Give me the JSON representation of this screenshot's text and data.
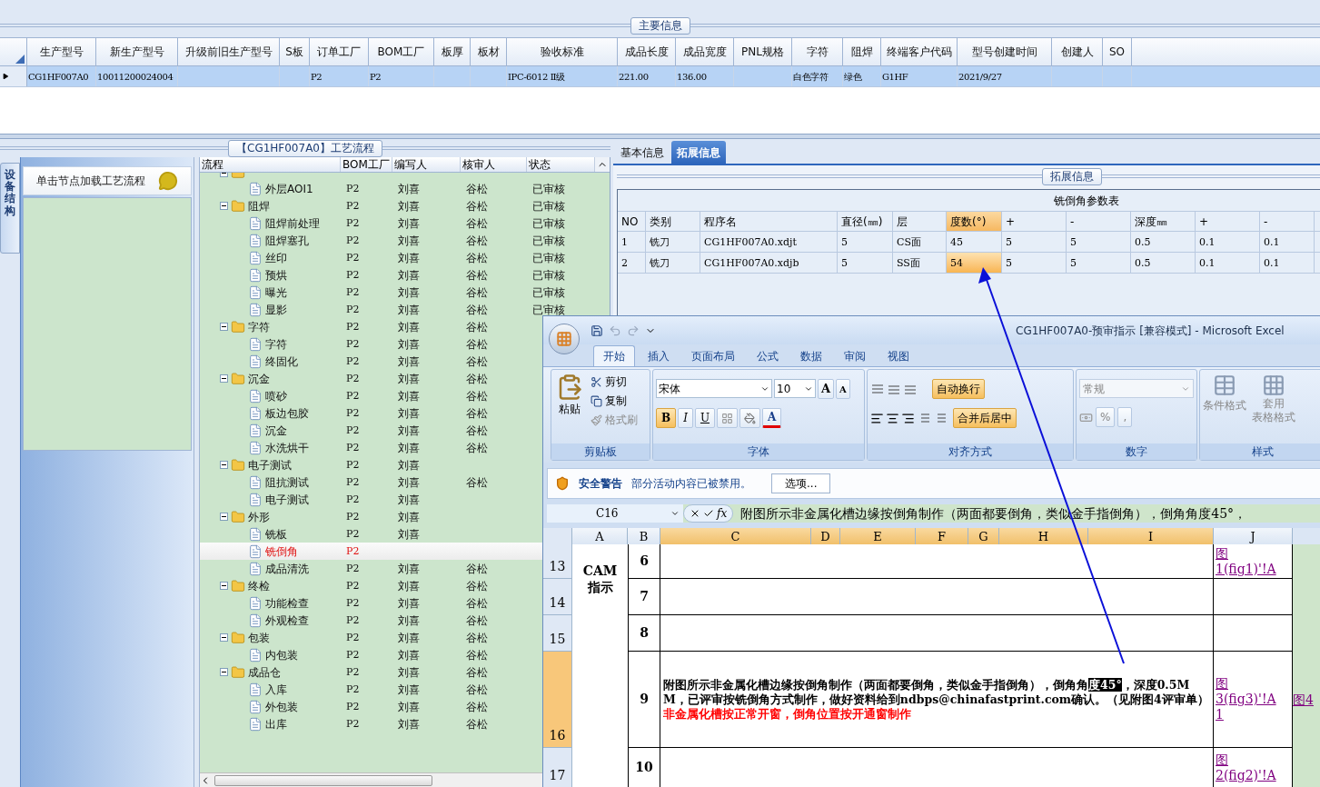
{
  "main_info": {
    "title": "主要信息",
    "columns": [
      "生产型号",
      "新生产型号",
      "升级前旧生产型号",
      "S板",
      "订单工厂",
      "BOM工厂",
      "板厚",
      "板材",
      "验收标准",
      "成品长度",
      "成品宽度",
      "PNL规格",
      "字符",
      "阻焊",
      "终端客户代码",
      "型号创建时间",
      "创建人",
      "SO"
    ],
    "rows": [
      {
        "selected": true,
        "cells": [
          "CG1HF007A0",
          "10011200024004",
          null,
          null,
          "P2",
          "P2",
          null,
          null,
          "IPC-6012 Ⅱ级",
          "221.00",
          "136.00",
          null,
          "白色字符",
          "绿色",
          "G1HF",
          "2021/9/27",
          null,
          null
        ]
      }
    ]
  },
  "process": {
    "title": "【CG1HF007A0】工艺流程",
    "side_tab": "设备结构",
    "hint": "单击节点加载工艺流程",
    "columns": [
      "流程",
      "BOM工厂",
      "编写人",
      "核审人",
      "状态"
    ],
    "tree": [
      {
        "kind": "folder",
        "selected": false,
        "children": [
          {
            "kind": "file",
            "label": "外层AOI1",
            "factory": "P2",
            "author": "刘喜",
            "reviewer": "谷松",
            "status": "已审核",
            "selected": false
          }
        ]
      },
      {
        "kind": "folder",
        "label": "阻焊",
        "factory": "P2",
        "author": "刘喜",
        "reviewer": "谷松",
        "status": "已审核",
        "selected": false,
        "children": [
          {
            "kind": "file",
            "label": "阻焊前处理",
            "factory": "P2",
            "author": "刘喜",
            "reviewer": "谷松",
            "status": "已审核",
            "selected": false
          },
          {
            "kind": "file",
            "label": "阻焊塞孔",
            "factory": "P2",
            "author": "刘喜",
            "reviewer": "谷松",
            "status": "已审核",
            "selected": false
          },
          {
            "kind": "file",
            "label": "丝印",
            "factory": "P2",
            "author": "刘喜",
            "reviewer": "谷松",
            "status": "已审核",
            "selected": false
          },
          {
            "kind": "file",
            "label": "预烘",
            "factory": "P2",
            "author": "刘喜",
            "reviewer": "谷松",
            "status": "已审核",
            "selected": false
          },
          {
            "kind": "file",
            "label": "曝光",
            "factory": "P2",
            "author": "刘喜",
            "reviewer": "谷松",
            "status": "已审核",
            "selected": false
          },
          {
            "kind": "file",
            "label": "显影",
            "factory": "P2",
            "author": "刘喜",
            "reviewer": "谷松",
            "status": "已审核",
            "selected": false
          }
        ]
      },
      {
        "kind": "folder",
        "label": "字符",
        "factory": "P2",
        "author": "刘喜",
        "reviewer": "谷松",
        "selected": false,
        "children": [
          {
            "kind": "file",
            "label": "字符",
            "factory": "P2",
            "author": "刘喜",
            "reviewer": "谷松",
            "selected": false
          },
          {
            "kind": "file",
            "label": "终固化",
            "factory": "P2",
            "author": "刘喜",
            "reviewer": "谷松",
            "selected": false
          }
        ]
      },
      {
        "kind": "folder",
        "label": "沉金",
        "factory": "P2",
        "author": "刘喜",
        "reviewer": "谷松",
        "selected": false,
        "children": [
          {
            "kind": "file",
            "label": "喷砂",
            "factory": "P2",
            "author": "刘喜",
            "reviewer": "谷松",
            "selected": false
          },
          {
            "kind": "file",
            "label": "板边包胶",
            "factory": "P2",
            "author": "刘喜",
            "reviewer": "谷松",
            "selected": false
          },
          {
            "kind": "file",
            "label": "沉金",
            "factory": "P2",
            "author": "刘喜",
            "reviewer": "谷松",
            "selected": false
          },
          {
            "kind": "file",
            "label": "水洗烘干",
            "factory": "P2",
            "author": "刘喜",
            "reviewer": "谷松",
            "selected": false
          }
        ]
      },
      {
        "kind": "folder",
        "label": "电子测试",
        "factory": "P2",
        "author": "刘喜",
        "selected": false,
        "children": [
          {
            "kind": "file",
            "label": "阻抗测试",
            "factory": "P2",
            "author": "刘喜",
            "reviewer": "谷松",
            "selected": false
          },
          {
            "kind": "file",
            "label": "电子测试",
            "factory": "P2",
            "author": "刘喜",
            "selected": false
          }
        ]
      },
      {
        "kind": "folder",
        "label": "外形",
        "factory": "P2",
        "author": "刘喜",
        "selected": false,
        "children": [
          {
            "kind": "file",
            "label": "铣板",
            "factory": "P2",
            "author": "刘喜",
            "selected": false
          },
          {
            "kind": "file",
            "label": "铣倒角",
            "factory": "P2",
            "selected": true
          },
          {
            "kind": "file",
            "label": "成品清洗",
            "factory": "P2",
            "author": "刘喜",
            "reviewer": "谷松",
            "selected": false
          }
        ]
      },
      {
        "kind": "folder",
        "label": "终检",
        "factory": "P2",
        "author": "刘喜",
        "reviewer": "谷松",
        "selected": false,
        "children": [
          {
            "kind": "file",
            "label": "功能检查",
            "factory": "P2",
            "author": "刘喜",
            "reviewer": "谷松",
            "selected": false
          },
          {
            "kind": "file",
            "label": "外观检查",
            "factory": "P2",
            "author": "刘喜",
            "reviewer": "谷松",
            "selected": false
          }
        ]
      },
      {
        "kind": "folder",
        "label": "包装",
        "factory": "P2",
        "author": "刘喜",
        "reviewer": "谷松",
        "selected": false,
        "children": [
          {
            "kind": "file",
            "label": "内包装",
            "factory": "P2",
            "author": "刘喜",
            "reviewer": "谷松",
            "selected": false
          }
        ]
      },
      {
        "kind": "folder",
        "label": "成品仓",
        "factory": "P2",
        "author": "刘喜",
        "reviewer": "谷松",
        "selected": false,
        "children": [
          {
            "kind": "file",
            "label": "入库",
            "factory": "P2",
            "author": "刘喜",
            "reviewer": "谷松",
            "selected": false
          },
          {
            "kind": "file",
            "label": "外包装",
            "factory": "P2",
            "author": "刘喜",
            "reviewer": "谷松",
            "selected": false
          },
          {
            "kind": "file",
            "label": "出库",
            "factory": "P2",
            "author": "刘喜",
            "reviewer": "谷松",
            "selected": false
          }
        ]
      }
    ]
  },
  "detail": {
    "tabs": [
      {
        "label": "基本信息",
        "selected": false
      },
      {
        "label": "拓展信息",
        "selected": true
      }
    ],
    "group_title": "拓展信息",
    "table": {
      "title": "铣倒角参数表",
      "columns": [
        {
          "label": "NO",
          "selected": false
        },
        {
          "label": "类别",
          "selected": false
        },
        {
          "label": "程序名",
          "selected": false
        },
        {
          "label": "直径(㎜)",
          "selected": false
        },
        {
          "label": "层",
          "selected": false
        },
        {
          "label": "度数(°)",
          "selected": true
        },
        {
          "label": "+",
          "selected": false
        },
        {
          "label": "-",
          "selected": false
        },
        {
          "label": "深度㎜",
          "selected": false
        },
        {
          "label": "+",
          "selected": false
        },
        {
          "label": "-",
          "selected": false
        }
      ],
      "rows": [
        {
          "cells": [
            {
              "text": "1",
              "selected": false
            },
            {
              "text": "铣刀",
              "selected": false
            },
            {
              "text": "CG1HF007A0.xdjt",
              "selected": false
            },
            {
              "text": "5",
              "selected": false
            },
            {
              "text": "CS面",
              "selected": false
            },
            {
              "text": "45",
              "selected": false
            },
            {
              "text": "5",
              "selected": false
            },
            {
              "text": "5",
              "selected": false
            },
            {
              "text": "0.5",
              "selected": false
            },
            {
              "text": "0.1",
              "selected": false
            },
            {
              "text": "0.1",
              "selected": false
            }
          ]
        },
        {
          "cells": [
            {
              "text": "2",
              "selected": false
            },
            {
              "text": "铣刀",
              "selected": false
            },
            {
              "text": "CG1HF007A0.xdjb",
              "selected": false
            },
            {
              "text": "5",
              "selected": false
            },
            {
              "text": "SS面",
              "selected": false
            },
            {
              "text": "54",
              "selected": true
            },
            {
              "text": "5",
              "selected": false
            },
            {
              "text": "5",
              "selected": false
            },
            {
              "text": "0.5",
              "selected": false
            },
            {
              "text": "0.1",
              "selected": false
            },
            {
              "text": "0.1",
              "selected": false
            }
          ]
        }
      ]
    }
  },
  "excel": {
    "title": "CG1HF007A0-预审指示  [兼容模式] - Microsoft Excel",
    "tabs": [
      {
        "label": "开始",
        "selected": true
      },
      {
        "label": "插入",
        "selected": false
      },
      {
        "label": "页面布局",
        "selected": false
      },
      {
        "label": "公式",
        "selected": false
      },
      {
        "label": "数据",
        "selected": false
      },
      {
        "label": "审阅",
        "selected": false
      },
      {
        "label": "视图",
        "selected": false
      }
    ],
    "clipboard": {
      "paste": "粘贴",
      "cut": "剪切",
      "copy": "复制",
      "format_painter": "格式刷",
      "label": "剪贴板"
    },
    "font": {
      "name": "宋体",
      "size": "10",
      "grow": "A",
      "shrink": "A",
      "bold": {
        "label": "B",
        "on": true
      },
      "italic": {
        "label": "I",
        "on": false
      },
      "underline": {
        "label": "U",
        "on": false
      },
      "color_letter": "A",
      "label": "字体"
    },
    "alignment": {
      "wrap": {
        "label": "自动换行",
        "on": true
      },
      "merge": {
        "label": "合并后居中",
        "on": true
      },
      "label": "对齐方式"
    },
    "number": {
      "format": "常规",
      "percent": "%",
      "comma": ",",
      "label": "数字"
    },
    "styles": {
      "conditional": "条件格式",
      "table": [
        "套用",
        "表格格式"
      ],
      "label": "样式"
    },
    "security": {
      "title": "安全警告",
      "message": "部分活动内容已被禁用。",
      "button": "选项..."
    },
    "formula": {
      "cell": "C16",
      "fx": "fx",
      "text": "附图所示非金属化槽边缘按倒角制作（两面都要倒角，类似金手指倒角），倒角角度45°，"
    },
    "columns": [
      {
        "label": "A",
        "selected": false
      },
      {
        "label": "B",
        "selected": false
      },
      {
        "label": "C",
        "selected": true
      },
      {
        "label": "D",
        "selected": true
      },
      {
        "label": "E",
        "selected": true
      },
      {
        "label": "F",
        "selected": true
      },
      {
        "label": "G",
        "selected": true
      },
      {
        "label": "H",
        "selected": true
      },
      {
        "label": "I",
        "selected": true
      },
      {
        "label": "J",
        "selected": false
      }
    ],
    "section": [
      "CAM",
      "指示"
    ],
    "rows": [
      {
        "number": "13",
        "selected": false,
        "item": "6",
        "link": [
          "图",
          "1(fig1)'!A"
        ]
      },
      {
        "number": "14",
        "selected": false,
        "item": "7"
      },
      {
        "number": "15",
        "selected": false,
        "item": "8"
      },
      {
        "number": "16",
        "selected": true,
        "item": "9",
        "text": [
          {
            "kind": "normal",
            "text": "附图所示非金属化槽边缘按倒角制作（两面都要倒角，类似金手指倒角），倒角角"
          },
          {
            "kind": "highlight",
            "text": "度45°"
          },
          {
            "kind": "normal",
            "text": "，深度0.5MM，已评审按铣倒角方式制作，做好资料给到ndbps@chinafastprint.com确认。（见附图4评审单）"
          },
          {
            "kind": "red",
            "text": "非金属化槽按正常开窗，倒角位置按开通窗制作"
          }
        ],
        "link": [
          "图",
          "3(fig3)'!A",
          "1"
        ],
        "extra": "图4"
      },
      {
        "number": "17",
        "selected": false,
        "item": "10",
        "link": [
          "图",
          "2(fig2)'!A"
        ]
      }
    ]
  }
}
